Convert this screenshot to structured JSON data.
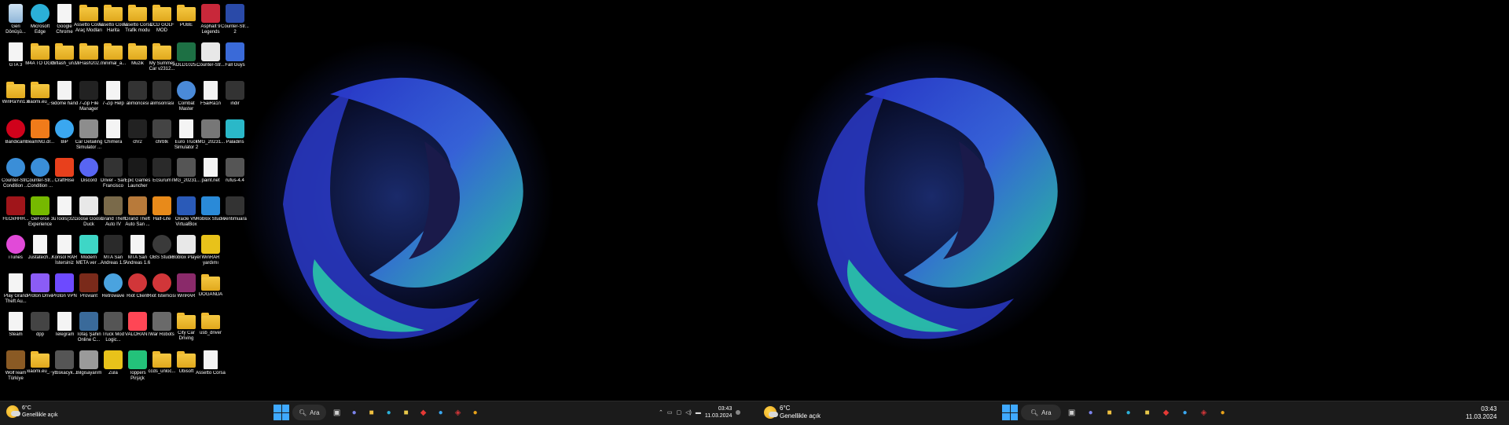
{
  "desktop_icons": [
    {
      "label": "Geri Dönüşü...",
      "icon": "recycle-bin-icon",
      "type": "bin",
      "color": "#8fb6d8"
    },
    {
      "label": "GTA 3",
      "icon": "gta3-icon",
      "type": "file",
      "color": "#4aa3df"
    },
    {
      "label": "WinRaYin1.0",
      "icon": "folder-icon",
      "type": "folder",
      "color": ""
    },
    {
      "label": "Bandicam",
      "icon": "bandicam-icon",
      "type": "circle",
      "color": "#d0021b"
    },
    {
      "label": "Counter-Str... Condition ...",
      "icon": "counter-strike-icon",
      "type": "circle",
      "color": "#3a8ed8"
    },
    {
      "label": "FEOxHHH...",
      "icon": "game-icon",
      "type": "app",
      "color": "#a0151a"
    },
    {
      "label": "iTunes",
      "icon": "itunes-icon",
      "type": "circle",
      "color": "#e14ad8"
    },
    {
      "label": "Play Grand Theft Au...",
      "icon": "file-icon",
      "type": "file",
      "color": ""
    },
    {
      "label": "Steam",
      "icon": "file-icon",
      "type": "file",
      "color": ""
    },
    {
      "label": "WolfTeam Türkiye",
      "icon": "wolfteam-icon",
      "type": "app",
      "color": "#8a5a24"
    },
    {
      "label": "Microsoft Edge",
      "icon": "edge-icon",
      "type": "circle",
      "color": "#2bb0d8"
    },
    {
      "label": "M4A TO OGG",
      "icon": "folder-icon",
      "type": "folder",
      "color": ""
    },
    {
      "label": "xiaomi.eu_...",
      "icon": "folder-icon",
      "type": "folder",
      "color": ""
    },
    {
      "label": "BeamNG.dr...",
      "icon": "beamng-icon",
      "type": "app",
      "color": "#f07b1a"
    },
    {
      "label": "Counter-Str... Condition ...",
      "icon": "counter-strike-icon",
      "type": "circle",
      "color": "#3a8ed8"
    },
    {
      "label": "GeForce Experience",
      "icon": "nvidia-icon",
      "type": "app",
      "color": "#76b900"
    },
    {
      "label": "Justatech...",
      "icon": "file-icon",
      "type": "file",
      "color": ""
    },
    {
      "label": "Proton Drive",
      "icon": "folder-icon",
      "type": "app",
      "color": "#8b5cf6"
    },
    {
      "label": "dpp",
      "icon": "unknown-icon",
      "type": "app",
      "color": "#444444"
    },
    {
      "label": "xiaomi.eu_...",
      "icon": "folder-icon",
      "type": "folder",
      "color": ""
    },
    {
      "label": "Google Chrome",
      "icon": "file-icon",
      "type": "file",
      "color": ""
    },
    {
      "label": "miflash_un...",
      "icon": "folder-icon",
      "type": "folder",
      "color": ""
    },
    {
      "label": "sidome hand",
      "icon": "file-icon",
      "type": "file",
      "color": ""
    },
    {
      "label": "BiP",
      "icon": "bip-icon",
      "type": "circle",
      "color": "#3aa7f0"
    },
    {
      "label": "CraftRise",
      "icon": "craftrise-icon",
      "type": "app",
      "color": "#e8401c"
    },
    {
      "label": "3uTools(32...",
      "icon": "file-icon",
      "type": "file",
      "color": ""
    },
    {
      "label": "Konsol RAR İstersiniz",
      "icon": "file-icon",
      "type": "file",
      "color": ""
    },
    {
      "label": "Proton VPN",
      "icon": "protonvpn-icon",
      "type": "app",
      "color": "#6d4aff"
    },
    {
      "label": "Telegram",
      "icon": "file-icon",
      "type": "file",
      "color": ""
    },
    {
      "label": "ytbskacyk...",
      "icon": "app-icon",
      "type": "app",
      "color": "#555555"
    },
    {
      "label": "Assetto Corsa Araç Modları",
      "icon": "folder-icon",
      "type": "folder",
      "color": ""
    },
    {
      "label": "MiFlash202...",
      "icon": "folder-icon",
      "type": "folder",
      "color": ""
    },
    {
      "label": "7-Zip File Manager",
      "icon": "7zip-icon",
      "type": "app",
      "color": "#222222"
    },
    {
      "label": "Car Detailing Simulator ...",
      "icon": "game-icon",
      "type": "app",
      "color": "#8d8d8d"
    },
    {
      "label": "Discord",
      "icon": "discord-icon",
      "type": "circle",
      "color": "#5865f2"
    },
    {
      "label": "Goose Goose Duck",
      "icon": "goose-icon",
      "type": "app",
      "color": "#e8e8e8"
    },
    {
      "label": "Modern META ver ...",
      "icon": "meta-icon",
      "type": "app",
      "color": "#3ed6c6"
    },
    {
      "label": "Proviant",
      "icon": "game-icon",
      "type": "app",
      "color": "#7a2a1a"
    },
    {
      "label": "Tofaş Şahin Online C...",
      "icon": "game-icon",
      "type": "app",
      "color": "#3a6a9a"
    },
    {
      "label": "Bilgisayarım",
      "icon": "computer-icon",
      "type": "app",
      "color": "#9a9a9a"
    },
    {
      "label": "Assetto Corsa Harita",
      "icon": "folder-icon",
      "type": "folder",
      "color": ""
    },
    {
      "label": "minimal_a...",
      "icon": "folder-icon",
      "type": "folder",
      "color": ""
    },
    {
      "label": "7-Zip Help",
      "icon": "help-icon",
      "type": "file",
      "color": ""
    },
    {
      "label": "Chimera",
      "icon": "file-icon",
      "type": "file",
      "color": ""
    },
    {
      "label": "Driver - San Francisco",
      "icon": "game-icon",
      "type": "app",
      "color": "#333333"
    },
    {
      "label": "Grand Theft Auto IV",
      "icon": "gta-icon",
      "type": "app",
      "color": "#7a6a4a"
    },
    {
      "label": "MTA San Andreas 1.5",
      "icon": "mta-icon",
      "type": "app",
      "color": "#2a2a2a"
    },
    {
      "label": "Retrowave",
      "icon": "retrowave-icon",
      "type": "circle",
      "color": "#4aa3df"
    },
    {
      "label": "Truck Mod Logic...",
      "icon": "game-icon",
      "type": "app",
      "color": "#555555"
    },
    {
      "label": "Zula",
      "icon": "zula-icon",
      "type": "app",
      "color": "#e8c21a"
    },
    {
      "label": "Assetto Corsa Trafik modu",
      "icon": "folder-icon",
      "type": "folder",
      "color": ""
    },
    {
      "label": "Muzik",
      "icon": "folder-icon",
      "type": "folder",
      "color": ""
    },
    {
      "label": "alimoncesi",
      "icon": "app-icon",
      "type": "app",
      "color": "#333333"
    },
    {
      "label": "chr2",
      "icon": "app-icon",
      "type": "app",
      "color": "#222222"
    },
    {
      "label": "Epic Games Launcher",
      "icon": "epic-games-icon",
      "type": "app",
      "color": "#1a1a1a"
    },
    {
      "label": "Grand Theft Auto San ...",
      "icon": "gta-icon",
      "type": "app",
      "color": "#b87a3a"
    },
    {
      "label": "MTA San Andreas 1.6",
      "icon": "file-icon",
      "type": "file",
      "color": ""
    },
    {
      "label": "Riot Client",
      "icon": "riot-icon",
      "type": "circle",
      "color": "#d13639"
    },
    {
      "label": "VALORANT",
      "icon": "valorant-icon",
      "type": "app",
      "color": "#ff4655"
    },
    {
      "label": "Toppers Pirşiçk",
      "icon": "app-icon",
      "type": "app",
      "color": "#23c27a"
    },
    {
      "label": "CCD GOLF MOD",
      "icon": "folder-icon",
      "type": "folder",
      "color": ""
    },
    {
      "label": "My Summer Car v2312...",
      "icon": "folder-icon",
      "type": "folder",
      "color": ""
    },
    {
      "label": "alimsonrasi",
      "icon": "app-icon",
      "type": "app",
      "color": "#333333"
    },
    {
      "label": "chrbtk",
      "icon": "app-icon",
      "type": "app",
      "color": "#444444"
    },
    {
      "label": "Ecsurum",
      "icon": "app-icon",
      "type": "app",
      "color": "#2a2a2a"
    },
    {
      "label": "Half-Life",
      "icon": "half-life-icon",
      "type": "app",
      "color": "#e88a1a"
    },
    {
      "label": "OBS Studio",
      "icon": "obs-icon",
      "type": "circle",
      "color": "#3a3a3a"
    },
    {
      "label": "Riot İstemcisi",
      "icon": "riot-icon",
      "type": "circle",
      "color": "#d13639"
    },
    {
      "label": "War Robots",
      "icon": "game-icon",
      "type": "app",
      "color": "#6a6a6a"
    },
    {
      "label": "ccds_unloc...",
      "icon": "folder-icon",
      "type": "folder",
      "color": ""
    },
    {
      "label": "PUBE",
      "icon": "folder-icon",
      "type": "folder",
      "color": ""
    },
    {
      "label": "AOLD1025...",
      "icon": "excel-icon",
      "type": "app",
      "color": "#1d7044"
    },
    {
      "label": "Combat Master",
      "icon": "game-icon",
      "type": "circle",
      "color": "#4a8ad8"
    },
    {
      "label": "Euro Truck Simulator 2",
      "icon": "file-icon",
      "type": "file",
      "color": ""
    },
    {
      "label": "IMG_20231...",
      "icon": "image-icon",
      "type": "app",
      "color": "#555555"
    },
    {
      "label": "Oracle VM VirtualBox",
      "icon": "virtualbox-icon",
      "type": "app",
      "color": "#2a5ab8"
    },
    {
      "label": "Roblox Player",
      "icon": "roblox-icon",
      "type": "app",
      "color": "#e8e8e8"
    },
    {
      "label": "WinRAR",
      "icon": "winrar-icon",
      "type": "app",
      "color": "#8a2a6a"
    },
    {
      "label": "City Car Driving",
      "icon": "folder-icon",
      "type": "folder",
      "color": ""
    },
    {
      "label": "Ubisoft",
      "icon": "folder-icon",
      "type": "folder",
      "color": ""
    },
    {
      "label": "Asphalt 9 Legends",
      "icon": "asphalt-icon",
      "type": "app",
      "color": "#c8283a"
    },
    {
      "label": "Counter-Str...",
      "icon": "counter-strike-icon",
      "type": "app",
      "color": "#e8e8e8"
    },
    {
      "label": "F5aiRa1n",
      "icon": "file-icon",
      "type": "file",
      "color": ""
    },
    {
      "label": "IMG_20231...",
      "icon": "image-icon",
      "type": "app",
      "color": "#777777"
    },
    {
      "label": "paint.net",
      "icon": "file-icon",
      "type": "file",
      "color": ""
    },
    {
      "label": "Roblox Studio",
      "icon": "roblox-studio-icon",
      "type": "app",
      "color": "#2a8ad8"
    },
    {
      "label": "WinRAR yardımı",
      "icon": "winrar-help-icon",
      "type": "app",
      "color": "#e8c21a"
    },
    {
      "label": "DOĞANDA",
      "icon": "folder-icon",
      "type": "folder",
      "color": ""
    },
    {
      "label": "usb_driver",
      "icon": "folder-icon",
      "type": "folder",
      "color": ""
    },
    {
      "label": "Assetto Corsa",
      "icon": "file-icon",
      "type": "file",
      "color": ""
    },
    {
      "label": "Counter-Str... 2",
      "icon": "cs2-icon",
      "type": "app",
      "color": "#2a4aa8"
    },
    {
      "label": "Fall Guys",
      "icon": "fall-guys-icon",
      "type": "app",
      "color": "#3a6ad8"
    },
    {
      "label": "indir",
      "icon": "image-icon",
      "type": "app",
      "color": "#333333"
    },
    {
      "label": "Paladins",
      "icon": "paladins-icon",
      "type": "app",
      "color": "#2ab8c8"
    },
    {
      "label": "rufus-4.4",
      "icon": "rufus-icon",
      "type": "app",
      "color": "#555555"
    },
    {
      "label": "ventimuara",
      "icon": "app-icon",
      "type": "app",
      "color": "#333333"
    }
  ],
  "monitor1": {
    "weather": {
      "temp": "6°C",
      "desc": "Genellikle açık"
    },
    "search_label": "Ara",
    "clock": {
      "time": "03:43",
      "date": "11.03.2024"
    }
  },
  "monitor2": {
    "weather": {
      "temp": "6°C",
      "desc": "Genellikle açık"
    },
    "search_label": "Ara",
    "clock": {
      "time": "03:43",
      "date": "11.03.2024"
    }
  },
  "taskbar_apps": [
    {
      "name": "task-view-icon",
      "glyph": "▣",
      "color": "#cfcfcf"
    },
    {
      "name": "chat-icon",
      "glyph": "●",
      "color": "#7b83eb"
    },
    {
      "name": "file-explorer-icon",
      "glyph": "■",
      "color": "#f0c040"
    },
    {
      "name": "edge-icon",
      "glyph": "●",
      "color": "#2bb0d8"
    },
    {
      "name": "store-icon",
      "glyph": "■",
      "color": "#e9c84a"
    },
    {
      "name": "red-app-icon",
      "glyph": "◆",
      "color": "#e53935"
    },
    {
      "name": "bip-icon",
      "glyph": "●",
      "color": "#3aa7f0"
    },
    {
      "name": "shield-app-icon",
      "glyph": "◈",
      "color": "#d13639"
    },
    {
      "name": "chrome-icon",
      "glyph": "●",
      "color": "#e8a21a"
    }
  ],
  "colors": {
    "taskbar": "#1b1b1b",
    "accent": "#3fa9ff"
  }
}
